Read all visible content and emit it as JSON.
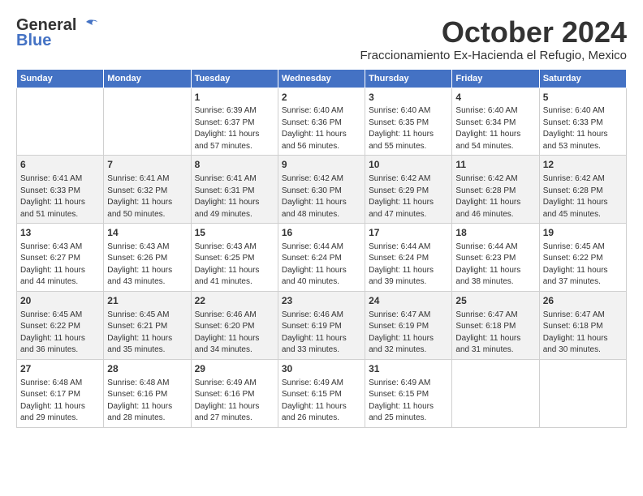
{
  "header": {
    "logo_general": "General",
    "logo_blue": "Blue",
    "month_title": "October 2024",
    "location": "Fraccionamiento Ex-Hacienda el Refugio, Mexico"
  },
  "weekdays": [
    "Sunday",
    "Monday",
    "Tuesday",
    "Wednesday",
    "Thursday",
    "Friday",
    "Saturday"
  ],
  "weeks": [
    [
      {
        "day": "",
        "sunrise": "",
        "sunset": "",
        "daylight": ""
      },
      {
        "day": "",
        "sunrise": "",
        "sunset": "",
        "daylight": ""
      },
      {
        "day": "1",
        "sunrise": "Sunrise: 6:39 AM",
        "sunset": "Sunset: 6:37 PM",
        "daylight": "Daylight: 11 hours and 57 minutes."
      },
      {
        "day": "2",
        "sunrise": "Sunrise: 6:40 AM",
        "sunset": "Sunset: 6:36 PM",
        "daylight": "Daylight: 11 hours and 56 minutes."
      },
      {
        "day": "3",
        "sunrise": "Sunrise: 6:40 AM",
        "sunset": "Sunset: 6:35 PM",
        "daylight": "Daylight: 11 hours and 55 minutes."
      },
      {
        "day": "4",
        "sunrise": "Sunrise: 6:40 AM",
        "sunset": "Sunset: 6:34 PM",
        "daylight": "Daylight: 11 hours and 54 minutes."
      },
      {
        "day": "5",
        "sunrise": "Sunrise: 6:40 AM",
        "sunset": "Sunset: 6:33 PM",
        "daylight": "Daylight: 11 hours and 53 minutes."
      }
    ],
    [
      {
        "day": "6",
        "sunrise": "Sunrise: 6:41 AM",
        "sunset": "Sunset: 6:33 PM",
        "daylight": "Daylight: 11 hours and 51 minutes."
      },
      {
        "day": "7",
        "sunrise": "Sunrise: 6:41 AM",
        "sunset": "Sunset: 6:32 PM",
        "daylight": "Daylight: 11 hours and 50 minutes."
      },
      {
        "day": "8",
        "sunrise": "Sunrise: 6:41 AM",
        "sunset": "Sunset: 6:31 PM",
        "daylight": "Daylight: 11 hours and 49 minutes."
      },
      {
        "day": "9",
        "sunrise": "Sunrise: 6:42 AM",
        "sunset": "Sunset: 6:30 PM",
        "daylight": "Daylight: 11 hours and 48 minutes."
      },
      {
        "day": "10",
        "sunrise": "Sunrise: 6:42 AM",
        "sunset": "Sunset: 6:29 PM",
        "daylight": "Daylight: 11 hours and 47 minutes."
      },
      {
        "day": "11",
        "sunrise": "Sunrise: 6:42 AM",
        "sunset": "Sunset: 6:28 PM",
        "daylight": "Daylight: 11 hours and 46 minutes."
      },
      {
        "day": "12",
        "sunrise": "Sunrise: 6:42 AM",
        "sunset": "Sunset: 6:28 PM",
        "daylight": "Daylight: 11 hours and 45 minutes."
      }
    ],
    [
      {
        "day": "13",
        "sunrise": "Sunrise: 6:43 AM",
        "sunset": "Sunset: 6:27 PM",
        "daylight": "Daylight: 11 hours and 44 minutes."
      },
      {
        "day": "14",
        "sunrise": "Sunrise: 6:43 AM",
        "sunset": "Sunset: 6:26 PM",
        "daylight": "Daylight: 11 hours and 43 minutes."
      },
      {
        "day": "15",
        "sunrise": "Sunrise: 6:43 AM",
        "sunset": "Sunset: 6:25 PM",
        "daylight": "Daylight: 11 hours and 41 minutes."
      },
      {
        "day": "16",
        "sunrise": "Sunrise: 6:44 AM",
        "sunset": "Sunset: 6:24 PM",
        "daylight": "Daylight: 11 hours and 40 minutes."
      },
      {
        "day": "17",
        "sunrise": "Sunrise: 6:44 AM",
        "sunset": "Sunset: 6:24 PM",
        "daylight": "Daylight: 11 hours and 39 minutes."
      },
      {
        "day": "18",
        "sunrise": "Sunrise: 6:44 AM",
        "sunset": "Sunset: 6:23 PM",
        "daylight": "Daylight: 11 hours and 38 minutes."
      },
      {
        "day": "19",
        "sunrise": "Sunrise: 6:45 AM",
        "sunset": "Sunset: 6:22 PM",
        "daylight": "Daylight: 11 hours and 37 minutes."
      }
    ],
    [
      {
        "day": "20",
        "sunrise": "Sunrise: 6:45 AM",
        "sunset": "Sunset: 6:22 PM",
        "daylight": "Daylight: 11 hours and 36 minutes."
      },
      {
        "day": "21",
        "sunrise": "Sunrise: 6:45 AM",
        "sunset": "Sunset: 6:21 PM",
        "daylight": "Daylight: 11 hours and 35 minutes."
      },
      {
        "day": "22",
        "sunrise": "Sunrise: 6:46 AM",
        "sunset": "Sunset: 6:20 PM",
        "daylight": "Daylight: 11 hours and 34 minutes."
      },
      {
        "day": "23",
        "sunrise": "Sunrise: 6:46 AM",
        "sunset": "Sunset: 6:19 PM",
        "daylight": "Daylight: 11 hours and 33 minutes."
      },
      {
        "day": "24",
        "sunrise": "Sunrise: 6:47 AM",
        "sunset": "Sunset: 6:19 PM",
        "daylight": "Daylight: 11 hours and 32 minutes."
      },
      {
        "day": "25",
        "sunrise": "Sunrise: 6:47 AM",
        "sunset": "Sunset: 6:18 PM",
        "daylight": "Daylight: 11 hours and 31 minutes."
      },
      {
        "day": "26",
        "sunrise": "Sunrise: 6:47 AM",
        "sunset": "Sunset: 6:18 PM",
        "daylight": "Daylight: 11 hours and 30 minutes."
      }
    ],
    [
      {
        "day": "27",
        "sunrise": "Sunrise: 6:48 AM",
        "sunset": "Sunset: 6:17 PM",
        "daylight": "Daylight: 11 hours and 29 minutes."
      },
      {
        "day": "28",
        "sunrise": "Sunrise: 6:48 AM",
        "sunset": "Sunset: 6:16 PM",
        "daylight": "Daylight: 11 hours and 28 minutes."
      },
      {
        "day": "29",
        "sunrise": "Sunrise: 6:49 AM",
        "sunset": "Sunset: 6:16 PM",
        "daylight": "Daylight: 11 hours and 27 minutes."
      },
      {
        "day": "30",
        "sunrise": "Sunrise: 6:49 AM",
        "sunset": "Sunset: 6:15 PM",
        "daylight": "Daylight: 11 hours and 26 minutes."
      },
      {
        "day": "31",
        "sunrise": "Sunrise: 6:49 AM",
        "sunset": "Sunset: 6:15 PM",
        "daylight": "Daylight: 11 hours and 25 minutes."
      },
      {
        "day": "",
        "sunrise": "",
        "sunset": "",
        "daylight": ""
      },
      {
        "day": "",
        "sunrise": "",
        "sunset": "",
        "daylight": ""
      }
    ]
  ]
}
